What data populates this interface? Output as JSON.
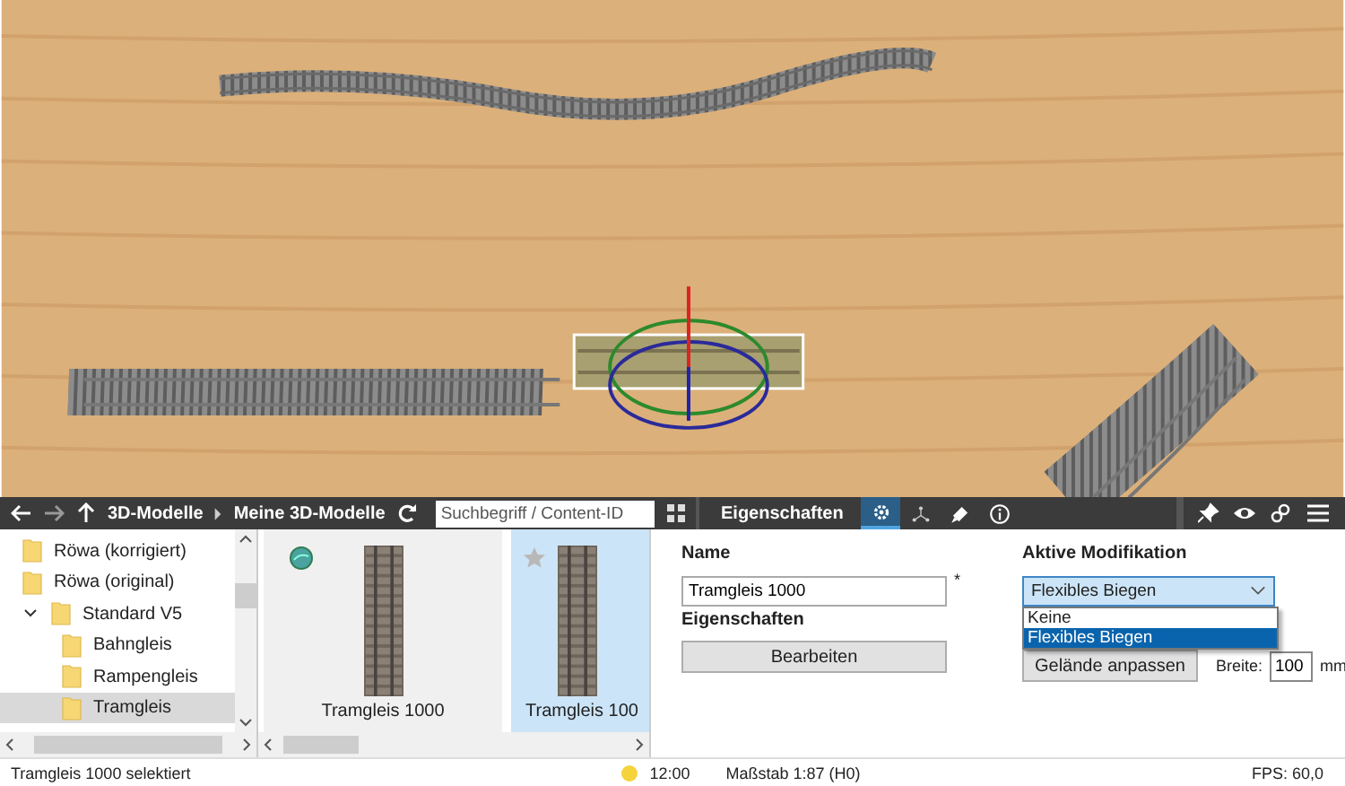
{
  "browser_toolbar": {
    "breadcrumb": [
      "3D-Modelle",
      "Meine 3D-Modelle"
    ],
    "search": {
      "placeholder": "Suchbegriff / Content-ID"
    }
  },
  "tree": [
    {
      "label": "Röwa (korrigiert)",
      "selected": false
    },
    {
      "label": "Röwa (original)",
      "selected": false
    },
    {
      "label": "Standard V5",
      "selected": false,
      "expanded": true,
      "children": [
        {
          "label": "Bahngleis",
          "selected": false
        },
        {
          "label": "Rampengleis",
          "selected": false
        },
        {
          "label": "Tramgleis",
          "selected": true
        }
      ]
    }
  ],
  "models": [
    {
      "label": "Tramgleis 1000",
      "selected": false,
      "kind": "globe"
    },
    {
      "label": "Tramgleis 100",
      "selected": true,
      "kind": "star"
    }
  ],
  "properties_toolbar": {
    "title": "Eigenschaften",
    "tabs": [
      {
        "kind": "gear",
        "selected": true
      },
      {
        "kind": "nodes",
        "selected": false
      },
      {
        "kind": "brush",
        "selected": false
      },
      {
        "kind": "info",
        "selected": false
      }
    ]
  },
  "properties": {
    "name_label": "Name",
    "name_value": "Tramgleis 1000",
    "required_mark": "*",
    "section_label": "Eigenschaften",
    "edit_button": "Bearbeiten",
    "modification_label": "Aktive Modifikation",
    "modification_value": "Flexibles Biegen",
    "options": [
      {
        "label": "Keine",
        "selected": false
      },
      {
        "label": "Flexibles Biegen",
        "selected": true
      }
    ],
    "terrain_button": "Gelände anpassen",
    "width_label": "Breite:",
    "width_value": "100",
    "unit": "mm"
  },
  "status_bar": {
    "message": "Tramgleis 1000 selektiert",
    "time": "12:00",
    "scale": "Maßstab 1:87 (H0)",
    "fps": "FPS: 60,0"
  }
}
